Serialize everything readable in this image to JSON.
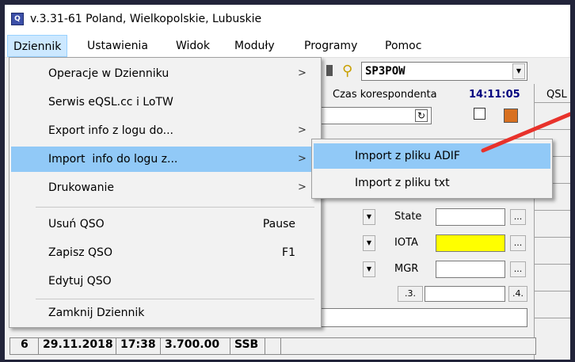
{
  "window": {
    "title": "v.3.31-61 Poland, Wielkopolskie, Lubuskie",
    "icon": "app-icon"
  },
  "menubar": [
    "Dziennik",
    "Ustawienia",
    "Widok",
    "Moduły",
    "Programy",
    "Pomoc"
  ],
  "menu": {
    "items": [
      {
        "label": "Operacje w Dzienniku",
        "submenu": true
      },
      {
        "label": "Serwis eQSL.cc i LoTW",
        "submenu": false
      },
      {
        "label": "Export info z logu do...",
        "submenu": true
      },
      {
        "label": "Import  info do logu z...",
        "submenu": true,
        "highlighted": true
      },
      {
        "label": "Drukowanie",
        "submenu": true
      },
      {
        "label": "Usuń QSO",
        "shortcut": "Pause"
      },
      {
        "label": "Zapisz QSO",
        "shortcut": "F1"
      },
      {
        "label": "Edytuj QSO",
        "shortcut": ""
      },
      {
        "label": "Zamknij Dziennik",
        "shortcut": ""
      }
    ],
    "arrow_glyph": ">"
  },
  "submenu": {
    "items": [
      {
        "label": "Import z pliku ADIF",
        "highlighted": true
      },
      {
        "label": "Import z pliku txt"
      }
    ]
  },
  "background": {
    "callsign": "SP3POW",
    "czas_label": "Czas korespondenta",
    "czas_value": "14:11:05",
    "qsl_header": "QSL",
    "state_label": "State",
    "iota_label": "IOTA",
    "mgr_label": "MGR",
    "btn_dots": "...",
    "btn_3": ".3.",
    "btn_4": ".4.",
    "iota_color": "#ffff00"
  },
  "log_row": {
    "nr": "6",
    "date": "29.11.2018",
    "time": "17:38",
    "freq": "3.700.00",
    "mode": "SSB"
  },
  "colors": {
    "highlight": "#91c9f7",
    "menubar_active": "#cce8ff",
    "pointer_arrow": "#e8322b",
    "time_color": "#000080"
  }
}
